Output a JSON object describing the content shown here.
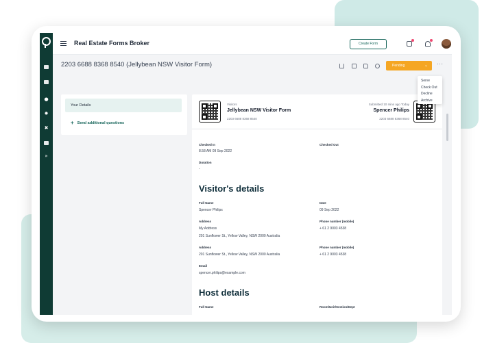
{
  "app": {
    "title": "Real Estate Forms Broker"
  },
  "topbar": {
    "create_form_label": "Create Form"
  },
  "page": {
    "title": "2203 6688 8368 8540  (Jellybean NSW Visitor Form)"
  },
  "status": {
    "label": "Pending",
    "accent": "#f5a623"
  },
  "status_menu": {
    "items": [
      "Serve",
      "Check Out",
      "Decline",
      "Archive"
    ]
  },
  "left_panel": {
    "items": [
      "Your Details"
    ],
    "add_label": "Send additional questions"
  },
  "form_header": {
    "category": "Visitors",
    "form_name": "Jellybean NSW Visitor Form",
    "form_id": "2203 6688 8368 8540",
    "submitted": "Submitted 10 mins ago Today",
    "submitter": "Spencer Philips",
    "record_id": "2203 6688 8368 8540"
  },
  "checkin": {
    "checked_in_label": "Checked In",
    "checked_in_value": "8.58 AM 09 Sep 2022",
    "checked_out_label": "Checked Out",
    "duration_label": "Duration",
    "duration_value": "-"
  },
  "visitor": {
    "heading": "Visitor's details",
    "full_name_label": "Full Name",
    "full_name": "Spencer Philips",
    "date_label": "Date",
    "date": "09 Sep 2022",
    "address_label": "Address",
    "address_title": "My Address",
    "address_line": "201 Sunflower St., Yellow Valley, NSW 2000 Australia",
    "phone_label": "Phone number (mobile)",
    "phone": "+ 61 2 9003 4538",
    "address2_label": "Address",
    "address2_line": "201 Sunflower St., Yellow Valley, NSW 2000 Australia",
    "phone2_label": "Phone number (mobile)",
    "phone2": "+ 61 2 9003 4538",
    "email_label": "Email",
    "email": "spencer.philips@example.com"
  },
  "host": {
    "heading": "Host details",
    "full_name_label": "Full Name",
    "room_label": "Room/Unit/Section/Dept"
  },
  "icons": [
    "menu-icon",
    "mail-icon",
    "bell-icon",
    "download-icon",
    "print-icon",
    "file-icon",
    "history-icon",
    "more-icon"
  ]
}
